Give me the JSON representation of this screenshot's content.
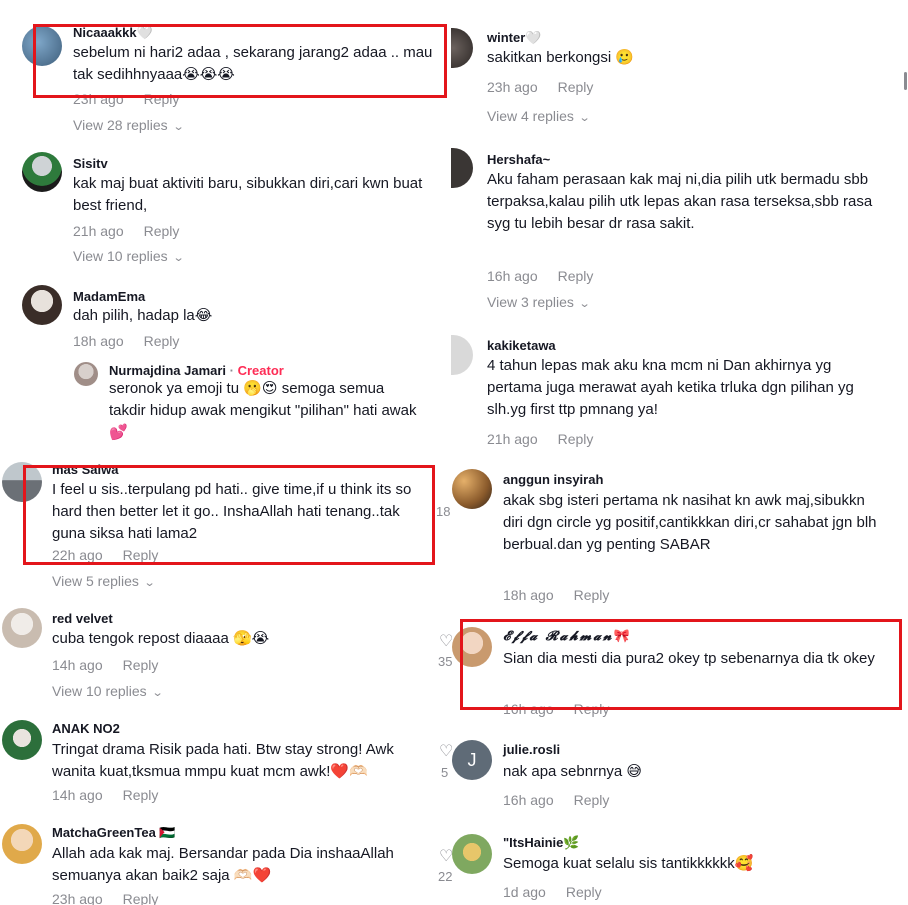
{
  "meta": {
    "reply_label": "Reply"
  },
  "left": [
    {
      "username": "Nicaaakkk",
      "suffix": "🤍",
      "text": "sebelum ni hari2 adaa , sekarang jarang2 adaa .. mau tak sedihhnyaaa😭😭😭",
      "time": "23h ago",
      "view_replies": "View 28 replies"
    },
    {
      "username": "Sisitv",
      "text": "kak maj buat aktiviti baru, sibukkan diri,cari kwn buat best friend,",
      "time": "21h ago",
      "view_replies": "View 10 replies"
    },
    {
      "username": "MadamEma",
      "text": "dah pilih, hadap la😂",
      "time": "18h ago"
    },
    {
      "username": "mas Salwa",
      "text": "I feel u sis..terpulang pd hati.. give time,if u think its so hard then better let it go.. InshaAllah hati tenang..tak guna siksa hati lama2",
      "time": "22h ago",
      "view_replies": "View 5 replies"
    },
    {
      "username": "red velvet",
      "text": "cuba tengok repost diaaaa 🫣😭",
      "time": "14h ago",
      "view_replies": "View 10 replies"
    },
    {
      "username": "ANAK NO2",
      "text": "Tringat drama Risik pada hati. Btw stay strong! Awk wanita kuat,tksmua mmpu kuat mcm awk!❤️🫶🏻",
      "time": "14h ago"
    },
    {
      "username": "MatchaGreenTea",
      "suffix": "🇵🇸",
      "text": "Allah ada kak maj. Bersandar pada Dia inshaaAllah semuanya akan baik2 saja 🫶🏻❤️",
      "time": "23h ago"
    }
  ],
  "nested_reply": {
    "username": "Nurmajdina Jamari",
    "creator_label": "Creator",
    "separator": " · ",
    "text": "seronok ya emoji tu 🫢😍 semoga semua takdir hidup awak mengikut \"pilihan\" hati awak 💕"
  },
  "left_counts": [
    "18",
    "35",
    "5",
    "22"
  ],
  "right": [
    {
      "username": "winter",
      "suffix": "🤍",
      "text": "sakitkan berkongsi 🥲",
      "time": "23h ago",
      "view_replies": "View 4 replies"
    },
    {
      "username": "Hershafa~",
      "text": "Aku faham perasaan kak maj ni,dia pilih utk bermadu sbb terpaksa,kalau pilih utk lepas akan rasa terseksa,sbb rasa syg tu lebih besar dr rasa sakit.",
      "time": "16h ago",
      "view_replies": "View 3 replies"
    },
    {
      "username": "kakiketawa",
      "text": "4 tahun lepas mak aku kna mcm ni Dan akhirnya yg pertama juga merawat ayah ketika trluka dgn pilihan yg slh.yg first ttp pmnang ya!",
      "time": "21h ago"
    },
    {
      "username": "anggun insyirah",
      "text": "akak sbg isteri pertama nk nasihat kn awk maj,sibukkn diri dgn circle yg positif,cantikkkan diri,cr sahabat jgn blh berbual.dan yg penting SABAR",
      "time": "18h ago"
    },
    {
      "username": "𝓔𝓯𝓯𝓪 𝓡𝓪𝓱𝓶𝓪𝓷",
      "suffix": "🎀",
      "text": "Sian dia mesti dia pura2 okey tp sebenarnya dia tk okey",
      "time": "16h ago"
    },
    {
      "username": "julie.rosli",
      "avatar_letter": "J",
      "text": "nak apa sebnrnya 😅",
      "time": "16h ago"
    },
    {
      "username": "\"ItsHainie",
      "suffix": "🌿",
      "text": "Semoga kuat selalu sis tantikkkkkk🥰",
      "time": "1d ago"
    }
  ]
}
